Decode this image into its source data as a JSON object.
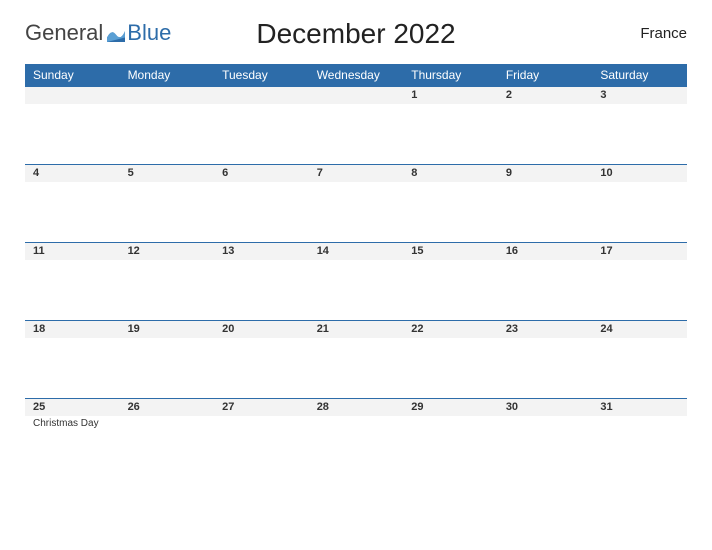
{
  "brand": {
    "name_part1": "General",
    "name_part2": "Blue"
  },
  "title": "December 2022",
  "region": "France",
  "dow": [
    "Sunday",
    "Monday",
    "Tuesday",
    "Wednesday",
    "Thursday",
    "Friday",
    "Saturday"
  ],
  "weeks": [
    [
      {
        "n": "",
        "e": ""
      },
      {
        "n": "",
        "e": ""
      },
      {
        "n": "",
        "e": ""
      },
      {
        "n": "",
        "e": ""
      },
      {
        "n": "1",
        "e": ""
      },
      {
        "n": "2",
        "e": ""
      },
      {
        "n": "3",
        "e": ""
      }
    ],
    [
      {
        "n": "4",
        "e": ""
      },
      {
        "n": "5",
        "e": ""
      },
      {
        "n": "6",
        "e": ""
      },
      {
        "n": "7",
        "e": ""
      },
      {
        "n": "8",
        "e": ""
      },
      {
        "n": "9",
        "e": ""
      },
      {
        "n": "10",
        "e": ""
      }
    ],
    [
      {
        "n": "11",
        "e": ""
      },
      {
        "n": "12",
        "e": ""
      },
      {
        "n": "13",
        "e": ""
      },
      {
        "n": "14",
        "e": ""
      },
      {
        "n": "15",
        "e": ""
      },
      {
        "n": "16",
        "e": ""
      },
      {
        "n": "17",
        "e": ""
      }
    ],
    [
      {
        "n": "18",
        "e": ""
      },
      {
        "n": "19",
        "e": ""
      },
      {
        "n": "20",
        "e": ""
      },
      {
        "n": "21",
        "e": ""
      },
      {
        "n": "22",
        "e": ""
      },
      {
        "n": "23",
        "e": ""
      },
      {
        "n": "24",
        "e": ""
      }
    ],
    [
      {
        "n": "25",
        "e": "Christmas Day"
      },
      {
        "n": "26",
        "e": ""
      },
      {
        "n": "27",
        "e": ""
      },
      {
        "n": "28",
        "e": ""
      },
      {
        "n": "29",
        "e": ""
      },
      {
        "n": "30",
        "e": ""
      },
      {
        "n": "31",
        "e": ""
      }
    ]
  ]
}
